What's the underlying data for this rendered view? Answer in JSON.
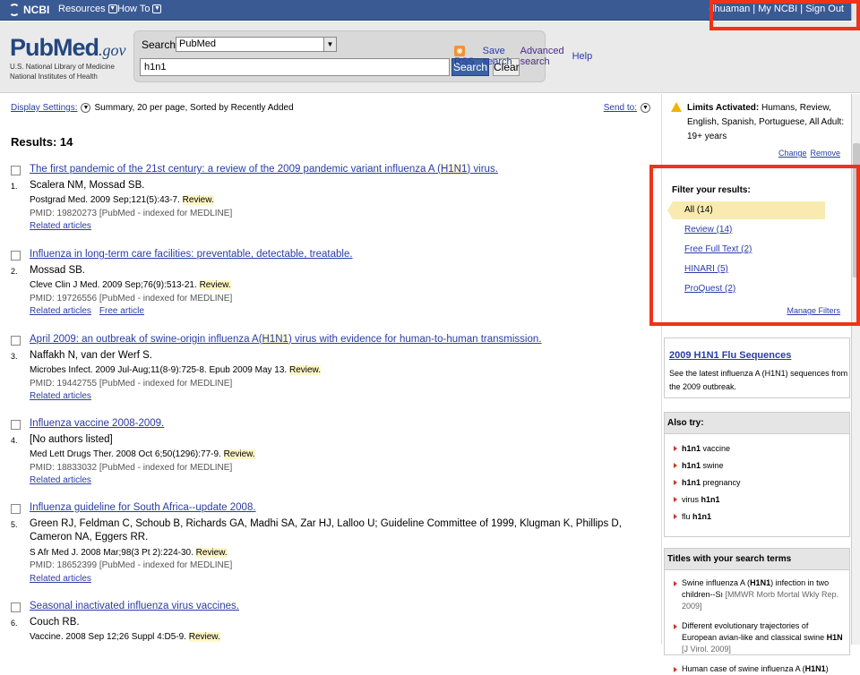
{
  "topbar": {
    "ncbi": "NCBI",
    "resources": "Resources",
    "howto": "How To",
    "user": "dhuaman",
    "my_ncbi": "My NCBI",
    "sign_out": "Sign Out",
    "sep": "|"
  },
  "header": {
    "logo_pub": "Pub",
    "logo_med": "Med",
    "logo_gov": ".gov",
    "logo_sub1": "U.S. National Library of Medicine",
    "logo_sub2": "National Institutes of Health",
    "search_label": "Search:",
    "database": "PubMed",
    "term": "h1n1",
    "search_button": "Search",
    "clear_button": "Clear",
    "rss": "RSS",
    "save_search": "Save search",
    "advanced_search": "Advanced search",
    "help": "Help"
  },
  "main": {
    "display_settings": "Display Settings:",
    "display_value": "Summary, 20 per page, Sorted by Recently Added",
    "send_to": "Send to:",
    "results_label": "Results: 14",
    "results": [
      {
        "number": "1.",
        "title_pre": "The first pandemic of the 21st century: a review of the 2009 pandemic variant influenza A (",
        "title_hl": "H1N1",
        "title_post": ") virus.",
        "authors": "Scalera NM, Mossad SB.",
        "citation": "Postgrad Med. 2009 Sep;121(5):43-7.",
        "review": "Review.",
        "pmid": "PMID: 19820273 [PubMed - indexed for MEDLINE]",
        "links": [
          "Related articles"
        ]
      },
      {
        "number": "2.",
        "title_pre": "Influenza in long-term care facilities: preventable, detectable, treatable.",
        "title_hl": "",
        "title_post": "",
        "authors": "Mossad SB.",
        "citation": "Cleve Clin J Med. 2009 Sep;76(9):513-21.",
        "review": "Review.",
        "pmid": "PMID: 19726556 [PubMed - indexed for MEDLINE]",
        "links": [
          "Related articles",
          "Free article"
        ]
      },
      {
        "number": "3.",
        "title_pre": "April 2009: an outbreak of swine-origin influenza A(",
        "title_hl": "H1N1",
        "title_post": ") virus with evidence for human-to-human transmission.",
        "authors": "Naffakh N, van der Werf S.",
        "citation": "Microbes Infect. 2009 Jul-Aug;11(8-9):725-8. Epub 2009 May 13.",
        "review": "Review.",
        "pmid": "PMID: 19442755 [PubMed - indexed for MEDLINE]",
        "links": [
          "Related articles"
        ]
      },
      {
        "number": "4.",
        "title_pre": "Influenza vaccine 2008-2009.",
        "title_hl": "",
        "title_post": "",
        "authors": "[No authors listed]",
        "citation": "Med Lett Drugs Ther. 2008 Oct 6;50(1296):77-9.",
        "review": "Review.",
        "pmid": "PMID: 18833032 [PubMed - indexed for MEDLINE]",
        "links": [
          "Related articles"
        ]
      },
      {
        "number": "5.",
        "title_pre": "Influenza guideline for South Africa--update 2008.",
        "title_hl": "",
        "title_post": "",
        "authors": "Green RJ, Feldman C, Schoub B, Richards GA, Madhi SA, Zar HJ, Lalloo U; Guideline Committee of 1999, Klugman K, Phillips D, Cameron NA, Eggers RR.",
        "citation": "S Afr Med J. 2008 Mar;98(3 Pt 2):224-30.",
        "review": "Review.",
        "pmid": "PMID: 18652399 [PubMed - indexed for MEDLINE]",
        "links": [
          "Related articles"
        ]
      },
      {
        "number": "6.",
        "title_pre": "Seasonal inactivated influenza virus vaccines.",
        "title_hl": "",
        "title_post": "",
        "authors": "Couch RB.",
        "citation": "Vaccine. 2008 Sep 12;26 Suppl 4:D5-9.",
        "review": "Review.",
        "pmid": "",
        "links": []
      }
    ]
  },
  "sidebar": {
    "limits_bold": "Limits Activated:",
    "limits_text": "Humans, Review, English, Spanish, Portuguese, All Adult: 19+ years",
    "change": "Change",
    "remove": "Remove",
    "filter_heading": "Filter your results:",
    "filters": [
      "All (14)",
      "Review (14)",
      "Free Full Text (2)",
      "HINARI (5)",
      "ProQuest (2)"
    ],
    "manage_filters": "Manage Filters",
    "flu_title": "2009 H1N1 Flu Sequences",
    "flu_desc": "See the latest influenza A (H1N1) sequences from the 2009 outbreak.",
    "also_try_heading": "Also try:",
    "also_try": [
      {
        "bold": "h1n1",
        "rest": " vaccine",
        "bold_first": true
      },
      {
        "bold": "h1n1",
        "rest": " swine",
        "bold_first": true
      },
      {
        "bold": "h1n1",
        "rest": " pregnancy",
        "bold_first": true
      },
      {
        "bold": "h1n1",
        "rest": "virus ",
        "bold_first": false
      },
      {
        "bold": "h1n1",
        "rest": "flu ",
        "bold_first": false
      }
    ],
    "titles_heading": "Titles with your search terms",
    "titles": [
      {
        "text_pre": "Swine influenza A (",
        "hl": "H1N1",
        "text_post": ") infection in two children--Sı",
        "src": " [MMWR Morb Mortal Wkly Rep. 2009]"
      },
      {
        "text_pre": "Different evolutionary trajectories of European avian-like and classical swine ",
        "hl": "H1N",
        "text_post": "",
        "src": " [J Virol. 2009]"
      },
      {
        "text_pre": "Human case of swine influenza A (",
        "hl": "H1N1",
        "text_post": ")",
        "src": ""
      }
    ]
  },
  "colors": {
    "topbar": "#3a5a94",
    "link": "#2a3ba8",
    "annotation": "#f03218",
    "review_highlight": "#fff6c8",
    "filter_selected": "#f9eab0"
  }
}
